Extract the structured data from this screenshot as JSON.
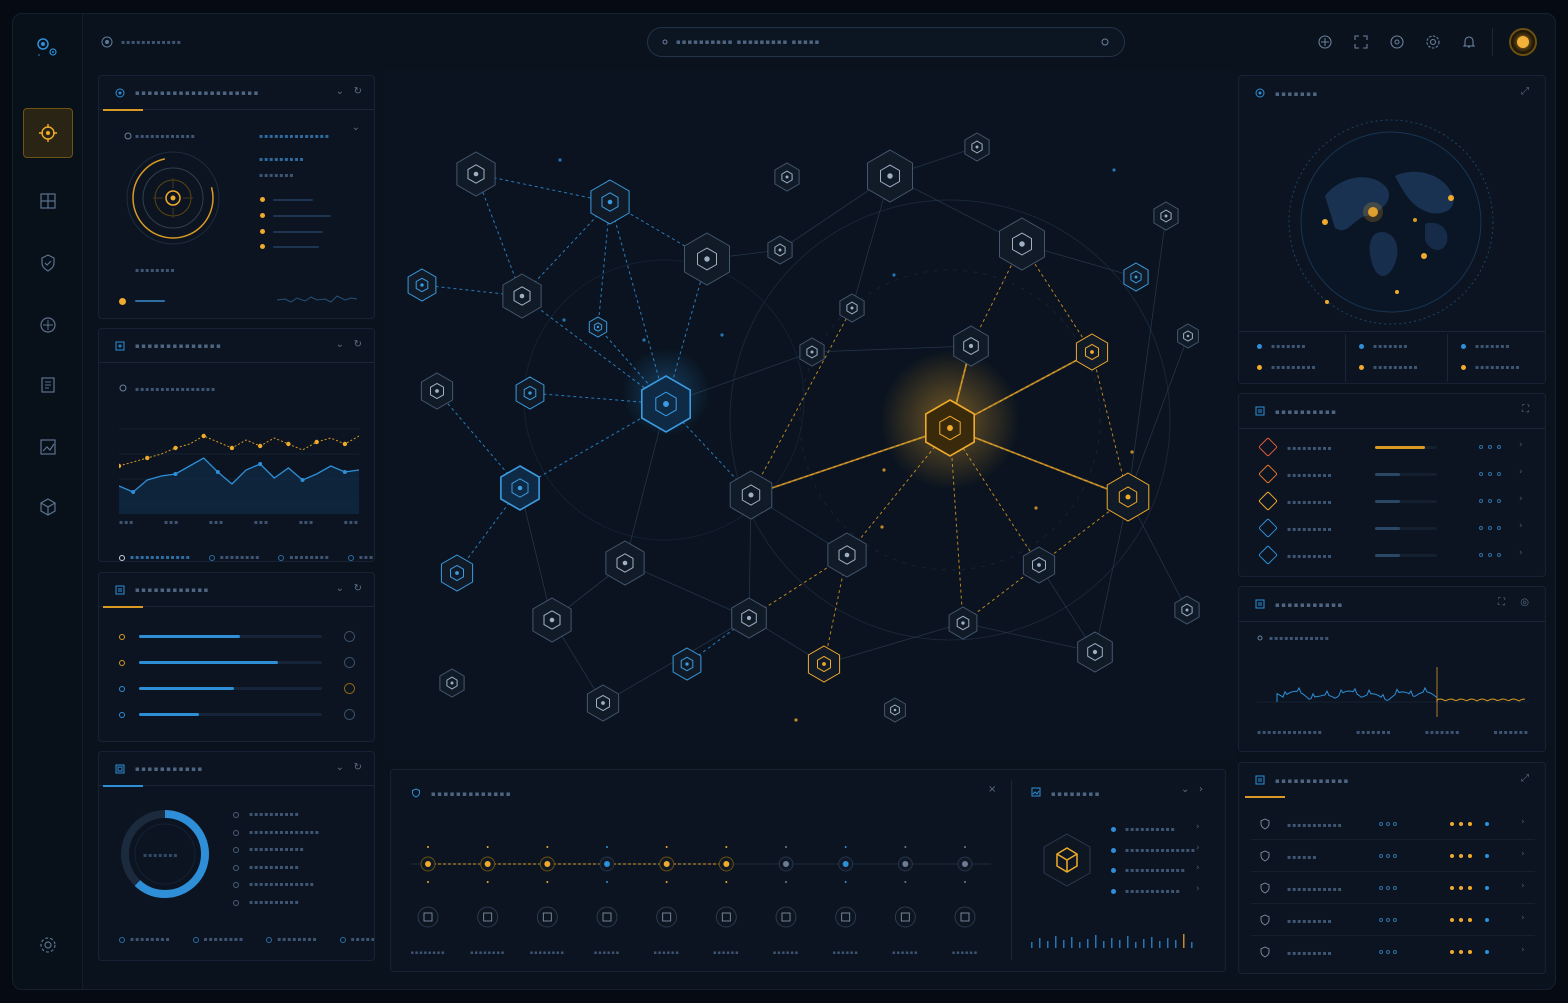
{
  "app": {
    "brand": "▪▪▪▪▪▪▪▪▪▪▪▪",
    "search_placeholder": "▪▪▪▪▪▪▪▪▪▪ ▪▪▪▪▪▪▪▪▪ ▪▪▪▪▪"
  },
  "nav": [
    "target-icon",
    "grid-icon",
    "shield-icon",
    "compass-icon",
    "list-icon",
    "chart-icon",
    "cube-icon",
    "gear-icon"
  ],
  "panels": {
    "scan": {
      "title": "▪▪▪▪▪▪▪▪▪▪▪▪▪▪▪▪▪▪▪▪",
      "label_a": "▪▪▪▪▪▪▪▪▪▪▪▪",
      "label_b": "▪▪▪▪▪▪▪▪▪▪▪▪▪▪",
      "label_c": "▪▪▪▪▪▪▪▪▪",
      "label_d": "▪▪▪▪▪▪▪",
      "label_e": "▪▪▪▪▪▪▪▪"
    },
    "trend": {
      "title": "▪▪▪▪▪▪▪▪▪▪▪▪▪▪",
      "label": "▪▪▪▪▪▪▪▪▪▪▪▪▪▪▪▪",
      "ticks": [
        "▪▪▪",
        "▪▪▪",
        "▪▪▪",
        "▪▪▪",
        "▪▪▪",
        "▪▪▪"
      ],
      "legend": [
        "▪▪▪▪▪▪▪▪▪▪▪▪",
        "▪▪▪▪▪▪▪▪",
        "▪▪▪▪▪▪▪▪",
        "▪▪▪▪▪▪"
      ]
    },
    "progress": {
      "title": "▪▪▪▪▪▪▪▪▪▪▪▪",
      "values": [
        0.55,
        0.76,
        0.52,
        0.33
      ]
    },
    "donut": {
      "title": "▪▪▪▪▪▪▪▪▪▪▪",
      "center": "▪▪▪▪▪▪▪",
      "value": 0.62,
      "items": [
        "▪▪▪▪▪▪▪▪▪▪",
        "▪▪▪▪▪▪▪▪▪▪▪▪▪▪",
        "▪▪▪▪▪▪▪▪▪▪▪",
        "▪▪▪▪▪▪▪▪▪▪",
        "▪▪▪▪▪▪▪▪▪▪▪▪▪",
        "▪▪▪▪▪▪▪▪▪▪"
      ],
      "legend": [
        "▪▪▪▪▪▪▪▪",
        "▪▪▪▪▪▪▪▪",
        "▪▪▪▪▪▪▪▪",
        "▪▪▪▪▪▪▪▪"
      ]
    },
    "globe": {
      "title": "▪▪▪▪▪▪▪",
      "stats": [
        "▪▪▪▪▪▪▪",
        "▪▪▪▪▪▪▪▪▪",
        "▪▪▪▪▪▪▪",
        "▪▪▪▪▪▪▪▪▪",
        "▪▪▪▪▪▪▪",
        "▪▪▪▪▪▪▪▪▪"
      ]
    },
    "threats": {
      "title": "▪▪▪▪▪▪▪▪▪▪",
      "rows": [
        "▪▪▪▪▪▪▪▪▪",
        "▪▪▪▪▪▪▪▪▪",
        "▪▪▪▪▪▪▪▪▪",
        "▪▪▪▪▪▪▪▪▪",
        "▪▪▪▪▪▪▪▪▪"
      ],
      "levels": [
        0.8,
        0.4,
        0.4,
        0.4,
        0.4
      ]
    },
    "signal": {
      "title": "▪▪▪▪▪▪▪▪▪▪▪",
      "label": "▪▪▪▪▪▪▪▪▪▪▪▪",
      "legend": [
        "▪▪▪▪▪▪▪▪▪▪▪▪▪",
        "▪▪▪▪▪▪▪",
        "▪▪▪▪▪▪▪",
        "▪▪▪▪▪▪▪"
      ]
    },
    "assets": {
      "title": "▪▪▪▪▪▪▪▪▪▪▪▪",
      "rows": [
        "▪▪▪▪▪▪▪▪▪▪▪",
        "▪▪▪▪▪▪",
        "▪▪▪▪▪▪▪▪▪▪▪",
        "▪▪▪▪▪▪▪▪▪",
        "▪▪▪▪▪▪▪▪▪"
      ]
    },
    "timeline": {
      "title": "▪▪▪▪▪▪▪▪▪▪▪▪▪",
      "captions": [
        "▪▪▪▪▪▪▪▪",
        "▪▪▪▪▪▪▪▪",
        "▪▪▪▪▪▪▪▪",
        "▪▪▪▪▪▪",
        "▪▪▪▪▪▪",
        "▪▪▪▪▪▪",
        "▪▪▪▪▪▪",
        "▪▪▪▪▪▪",
        "▪▪▪▪▪▪",
        "▪▪▪▪▪▪"
      ]
    },
    "node": {
      "title": "▪▪▪▪▪▪▪▪",
      "items": [
        "▪▪▪▪▪▪▪▪▪▪",
        "▪▪▪▪▪▪▪▪▪▪▪▪▪▪",
        "▪▪▪▪▪▪▪▪▪▪▪▪",
        "▪▪▪▪▪▪▪▪▪▪▪"
      ]
    }
  },
  "colors": {
    "accent": "#f0aa2c",
    "primary": "#2e8fd8",
    "bg": "#0a121e"
  }
}
